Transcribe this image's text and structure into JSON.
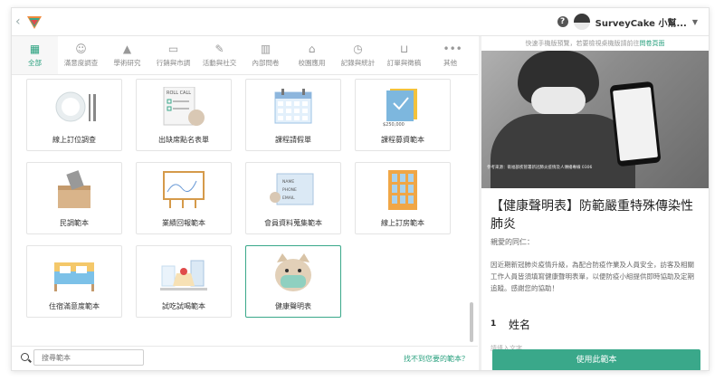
{
  "header": {
    "user_name": "SurveyCake 小幫..."
  },
  "categories": [
    {
      "label": "全部",
      "icon": "grid-icon",
      "active": true
    },
    {
      "label": "滿意度調查",
      "icon": "smile-icon"
    },
    {
      "label": "學術研究",
      "icon": "graduation-cap-icon"
    },
    {
      "label": "行銷與市調",
      "icon": "monitor-chart-icon"
    },
    {
      "label": "活動與社交",
      "icon": "pen-icon"
    },
    {
      "label": "內部問卷",
      "icon": "building-icon"
    },
    {
      "label": "校園應用",
      "icon": "school-icon"
    },
    {
      "label": "記錄與統計",
      "icon": "clock-doc-icon"
    },
    {
      "label": "訂單與徵稿",
      "icon": "cart-icon"
    },
    {
      "label": "其他",
      "icon": "more-dots-icon"
    }
  ],
  "templates": [
    {
      "label": "線上訂位調查",
      "art": "plate-icon"
    },
    {
      "label": "出缺席點名表單",
      "art": "roll-call-icon",
      "art_text": "ROLL CALL"
    },
    {
      "label": "課程請假單",
      "art": "calendar-icon"
    },
    {
      "label": "課程募資範本",
      "art": "crowdfund-icon",
      "art_text": "$250,000"
    },
    {
      "label": "民調範本",
      "art": "ballot-box-icon"
    },
    {
      "label": "業績回報範本",
      "art": "presentation-board-icon"
    },
    {
      "label": "會員資料蒐集範本",
      "art": "member-card-icon",
      "art_lines": [
        "NAME",
        "PHONE",
        "EMAIL"
      ]
    },
    {
      "label": "線上訂房範本",
      "art": "building-window-icon"
    },
    {
      "label": "住宿滿意度範本",
      "art": "bed-icon"
    },
    {
      "label": "試吃試喝範本",
      "art": "cake-icon"
    },
    {
      "label": "健康聲明表",
      "art": "masked-cat-icon",
      "selected": true
    }
  ],
  "search": {
    "placeholder": "搜尋範本"
  },
  "not_found_link": "找不到您要的範本？",
  "preview": {
    "hint": "快速手機版預覽，若要檢視桌機版請前往",
    "hint_link": "問卷頁面",
    "photo_caption": "參考來源：衛福部疾管署新冠肺炎疫情及人傳播專線 0306",
    "title": "【健康聲明表】防範嚴重特殊傳染性肺炎",
    "greeting": "親愛的同仁：",
    "description": "因近期新冠肺炎疫情升級，為配合防疫作業及人員安全，訪客及相關工作人員皆須填寫健康聲明表單，以便防疫小組提供即時協助及定期追蹤。感謝您的協助！",
    "question_number": "1",
    "question_label": "姓名",
    "question_hint": "請填入文字",
    "use_button": "使用此範本"
  },
  "colors": {
    "accent": "#3aa88a",
    "link": "#2aa17f"
  }
}
